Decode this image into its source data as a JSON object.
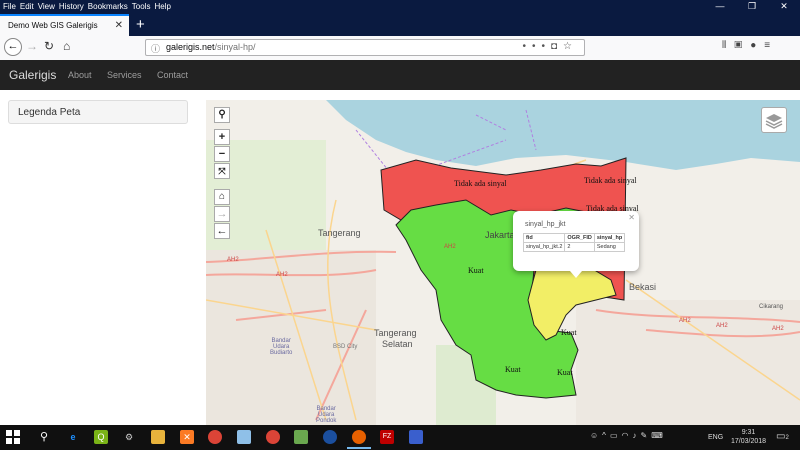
{
  "menu": [
    "File",
    "Edit",
    "View",
    "History",
    "Bookmarks",
    "Tools",
    "Help"
  ],
  "tab": {
    "title": "Demo Web GIS Galerigis"
  },
  "url": {
    "host": "galerigis.net",
    "path": "/sinyal-hp/"
  },
  "site": {
    "brand": "Galerigis",
    "nav": [
      "About",
      "Services",
      "Contact"
    ]
  },
  "legend": {
    "title": "Legenda Peta"
  },
  "map": {
    "labels": {
      "tidak1": "Tidak ada sinyal",
      "tidak2": "Tidak ada sinyal",
      "tidak3": "Tidak ada sinyal",
      "kuat1": "Kuat",
      "kuat2": "Kuat",
      "kuat3": "Kuat",
      "kuat4": "Kuat",
      "jakarta": "Jakarta"
    },
    "cities": {
      "tangerang": "Tangerang",
      "tangsel1": "Tangerang",
      "tangsel2": "Selatan",
      "bekasi": "Bekasi",
      "cikarang": "Cikarang",
      "bandara1a": "Bandar",
      "bandara1b": "Udara",
      "bandara1c": "Budiarto",
      "bandara2a": "Bandar",
      "bandara2b": "Udara",
      "bandara2c": "Pondok",
      "bsd": "BSD City"
    },
    "roads": {
      "ah2a": "AH2",
      "ah2b": "AH2",
      "ah2c": "AH2",
      "ah2d": "AH2",
      "ah2e": "AH2",
      "ah2f": "AH2"
    },
    "popup": {
      "title": "sinyal_hp_jkt",
      "headers": [
        "fid",
        "OGR_FID",
        "sinyal_hp"
      ],
      "row": [
        "sinyal_hp_jkt.2",
        "2",
        "Sedang"
      ]
    },
    "colors": {
      "red": "#ef5350",
      "green": "#66dd44",
      "yellow": "#f2ee66",
      "sea": "#aad3df"
    }
  },
  "taskbar": {
    "lang": "ENG",
    "time": "9:31",
    "date": "17/03/2018",
    "notifications": "2"
  }
}
